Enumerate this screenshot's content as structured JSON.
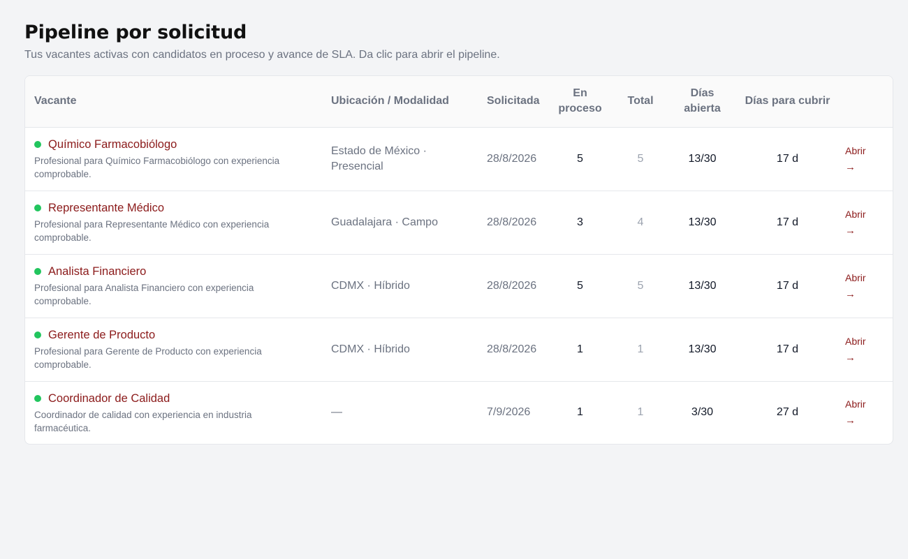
{
  "page": {
    "title": "Pipeline por solicitud",
    "subtitle": "Tus vacantes activas con candidatos en proceso y avance de SLA. Da clic para abrir el pipeline."
  },
  "table": {
    "headers": {
      "vacante": "Vacante",
      "ubicacion": "Ubicación / Modalidad",
      "solicitada": "Solicitada",
      "en_proceso": "En proceso",
      "total": "Total",
      "dias_abierta": "Días abierta",
      "dias_cubrir": "Días para cubrir"
    },
    "rows": [
      {
        "title": "Químico Farmacobiólogo",
        "description": "Profesional para Químico Farmacobiólogo con experiencia comprobable.",
        "location": "Estado de México · Presencial",
        "date": "28/8/2026",
        "in_process": "5",
        "total": "5",
        "days_open": "13/30",
        "days_to_fill": "17 d",
        "action": "Abrir",
        "arrow": "→"
      },
      {
        "title": "Representante Médico",
        "description": "Profesional para Representante Médico con experiencia comprobable.",
        "location": "Guadalajara · Campo",
        "date": "28/8/2026",
        "in_process": "3",
        "total": "4",
        "days_open": "13/30",
        "days_to_fill": "17 d",
        "action": "Abrir",
        "arrow": "→"
      },
      {
        "title": "Analista Financiero",
        "description": "Profesional para Analista Financiero con experiencia comprobable.",
        "location": "CDMX · Híbrido",
        "date": "28/8/2026",
        "in_process": "5",
        "total": "5",
        "days_open": "13/30",
        "days_to_fill": "17 d",
        "action": "Abrir",
        "arrow": "→"
      },
      {
        "title": "Gerente de Producto",
        "description": "Profesional para Gerente de Producto con experiencia comprobable.",
        "location": "CDMX · Híbrido",
        "date": "28/8/2026",
        "in_process": "1",
        "total": "1",
        "days_open": "13/30",
        "days_to_fill": "17 d",
        "action": "Abrir",
        "arrow": "→"
      },
      {
        "title": "Coordinador de Calidad",
        "description": "Coordinador de calidad con experiencia en industria farmacéutica.",
        "location": "—",
        "date": "7/9/2026",
        "in_process": "1",
        "total": "1",
        "days_open": "3/30",
        "days_to_fill": "27 d",
        "action": "Abrir",
        "arrow": "→"
      }
    ]
  },
  "colors": {
    "accent": "#8b1a1a",
    "status_dot": "#22c55e",
    "background": "#f3f4f6"
  }
}
